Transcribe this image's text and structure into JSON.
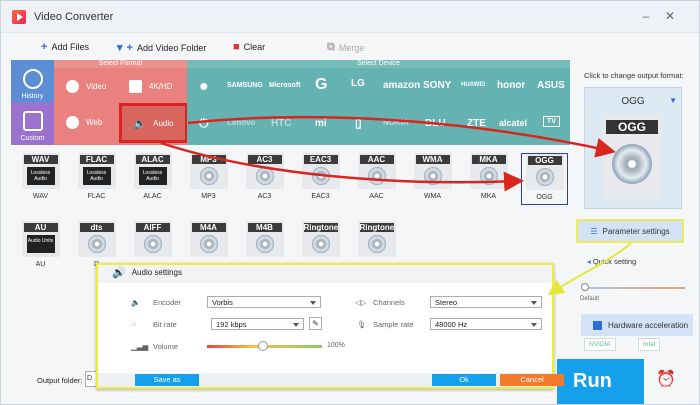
{
  "app": {
    "title": "Video Converter"
  },
  "toolbar": {
    "add_files": "Add Files",
    "add_video_folder": "Add Video Folder",
    "clear": "Clear",
    "merge": "Merge"
  },
  "sidebar": {
    "history": "History",
    "custom": "Custom"
  },
  "format_panel": {
    "header": "Select Format",
    "video": "Video",
    "fourk": "4K/HD",
    "web": "Web",
    "audio": "Audio"
  },
  "device_panel": {
    "header": "Select Device",
    "brands_row1": [
      "SAMSUNG",
      "Microsoft",
      "G",
      "LG",
      "amazon",
      "SONY",
      "HUAWEI",
      "honor",
      "ASUS"
    ],
    "brands_row2": [
      "Lenovo",
      "HTC",
      "mi",
      "NOKIA",
      "BLU",
      "ZTE",
      "alcatel",
      "TV"
    ]
  },
  "formats": [
    {
      "tag": "WAV",
      "sub": "Lossless Audio",
      "name": "WAV"
    },
    {
      "tag": "FLAC",
      "sub": "Lossless Audio",
      "name": "FLAC"
    },
    {
      "tag": "ALAC",
      "sub": "Lossless Audio",
      "name": "ALAC"
    },
    {
      "tag": "MP3",
      "sub": "",
      "name": "MP3"
    },
    {
      "tag": "AC3",
      "sub": "",
      "name": "AC3"
    },
    {
      "tag": "EAC3",
      "sub": "",
      "name": "EAC3"
    },
    {
      "tag": "AAC",
      "sub": "",
      "name": "AAC"
    },
    {
      "tag": "WMA",
      "sub": "",
      "name": "WMA"
    },
    {
      "tag": "MKA",
      "sub": "",
      "name": "MKA"
    },
    {
      "tag": "OGG",
      "sub": "",
      "name": "OGG"
    },
    {
      "tag": "AU",
      "sub": "Audio Units",
      "name": "AU"
    },
    {
      "tag": "dts",
      "sub": "",
      "name": "D"
    },
    {
      "tag": "AIFF",
      "sub": "",
      "name": ""
    },
    {
      "tag": "M4A",
      "sub": "",
      "name": ""
    },
    {
      "tag": "M4B",
      "sub": "",
      "name": ""
    },
    {
      "tag": "Ringtone",
      "sub": "",
      "name": ""
    },
    {
      "tag": "Ringtone",
      "sub": "",
      "name": ""
    }
  ],
  "right": {
    "change_label": "Click to change output format:",
    "output_format": "OGG",
    "cover_label": "OGG",
    "param_settings": "Parameter settings",
    "quick_setting": "Quick setting",
    "default_label": "Default",
    "hw_accel": "Hardware acceleration",
    "nvidia": "NVIDIA",
    "intel": "Intel",
    "run": "Run"
  },
  "output": {
    "label": "Output folder:",
    "value": "D"
  },
  "dialog": {
    "title": "Audio settings",
    "encoder_label": "Encoder",
    "encoder_value": "Vorbis",
    "bitrate_label": "Bit rate",
    "bitrate_value": "192 kbps",
    "volume_label": "Volume",
    "volume_value": "100%",
    "volume_level": 0.5,
    "channels_label": "Channels",
    "channels_value": "Stereo",
    "samplerate_label": "Sample rate",
    "samplerate_value": "48000 Hz",
    "save_as": "Save as",
    "ok": "Ok",
    "cancel": "Cancel"
  },
  "colors": {
    "format_bg": "#e9827f",
    "device_bg": "#64b3b2",
    "run_bg": "#14a0ea",
    "highlight_yellow": "#ecec43",
    "arrow_red": "#d8261f"
  }
}
